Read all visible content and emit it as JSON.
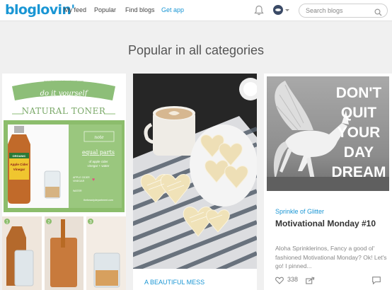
{
  "header": {
    "logo": "bloglovin'",
    "nav": [
      {
        "label": "My feed"
      },
      {
        "label": "Popular"
      },
      {
        "label": "Find blogs"
      },
      {
        "label": "Get app"
      }
    ],
    "notifications_icon": "bell-icon",
    "avatar_icon": "avatar-icon",
    "search_placeholder": "Search blogs",
    "search_icon": "search-icon",
    "accent_color": "#1a96d4"
  },
  "page": {
    "title": "Popular in all categories"
  },
  "cards": [
    {
      "image": {
        "small_caption": "www.thebeautydepartment.com",
        "script_text": "do it yourself",
        "banner_text": "NATURAL TONER",
        "bottle_label_top": "ORGANIC",
        "bottle_label_main": "Apple Cider Vinegar",
        "note_title": "note",
        "note_body": "equal parts",
        "note_sub": "of apple cider vinegar + water",
        "callout_1": "APPLE CIDER VINEGAR",
        "callout_2": "WATER",
        "credit": "thebeautydepartment.com",
        "steps": [
          "1",
          "2",
          "3"
        ]
      }
    },
    {
      "source": "A BEAUTIFUL MESS"
    },
    {
      "image": {
        "poster_text": [
          "DON'T",
          "QUIT",
          "YOUR",
          "DAY",
          "DREAM"
        ]
      },
      "source": "Sprinkle of Glitter",
      "title": "Motivational Monday #10",
      "excerpt": "Aloha Sprinklerinos, Fancy a good ol' fashioned Motivational Monday? Ok! Let's go! I pinned...",
      "likes": "338",
      "like_icon": "heart-icon",
      "share_icon": "share-icon",
      "comment_icon": "comment-icon"
    }
  ]
}
